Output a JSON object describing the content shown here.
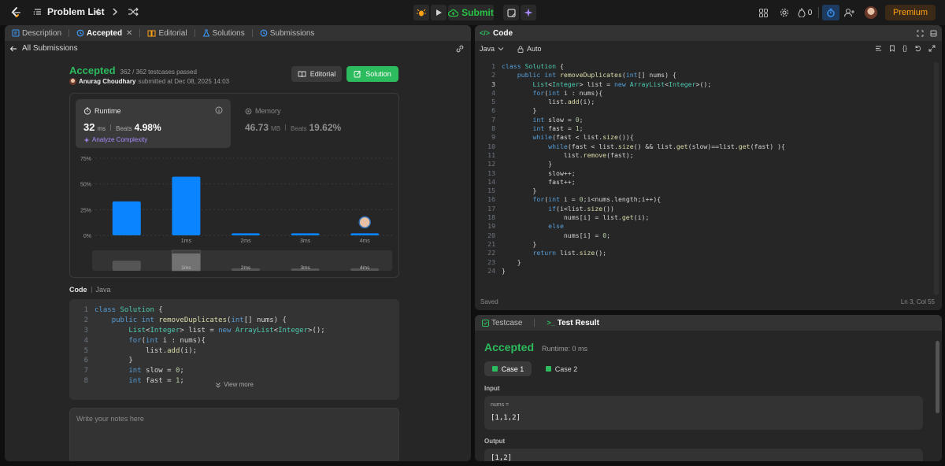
{
  "topbar": {
    "problem_list_label": "Problem List",
    "submit_label": "Submit",
    "streak_count": "0",
    "premium_label": "Premium"
  },
  "left_panel": {
    "tabs": [
      {
        "label": "Description"
      },
      {
        "label": "Accepted"
      },
      {
        "label": "Editorial"
      },
      {
        "label": "Solutions"
      },
      {
        "label": "Submissions"
      }
    ],
    "back_label": "All Submissions",
    "status": "Accepted",
    "testcases": "362 / 362 testcases passed",
    "author": "Anurag Choudhary",
    "submitted_text": "submitted at Dec 08, 2025 14:03",
    "editorial_btn": "Editorial",
    "solution_btn": "Solution",
    "runtime": {
      "title": "Runtime",
      "value": "32",
      "unit": "ms",
      "beats_label": "Beats",
      "beats_value": "4.98%",
      "analyze_label": "Analyze Complexity"
    },
    "memory": {
      "title": "Memory",
      "value": "46.73",
      "unit": "MB",
      "beats_label": "Beats",
      "beats_value": "19.62%"
    },
    "code_label": "Code",
    "code_lang": "Java",
    "view_more": "View more",
    "notes_placeholder": "Write your notes here"
  },
  "chart_data": {
    "type": "bar",
    "categories": [
      "",
      "1ms",
      "2ms",
      "3ms",
      "4ms"
    ],
    "values": [
      33,
      57,
      2,
      2,
      2
    ],
    "yticks": [
      "75%",
      "50%",
      "25%",
      "0%"
    ],
    "ylim": [
      0,
      75
    ],
    "mini_labels": [
      "1ms",
      "2ms",
      "3ms",
      "4ms"
    ],
    "bar_color": "#0a84ff"
  },
  "code_panel": {
    "title": "Code",
    "language": "Java",
    "mode": "Auto",
    "saved": "Saved",
    "cursor": "Ln 3, Col 55"
  },
  "code_lines": [
    "class Solution {",
    "    public int removeDuplicates(int[] nums) {",
    "        List<Integer> list = new ArrayList<Integer>();",
    "        for(int i : nums){",
    "            list.add(i);",
    "        }",
    "        int slow = 0;",
    "        int fast = 1;",
    "        while(fast < list.size()){",
    "            while(fast < list.size() && list.get(slow)==list.get(fast) ){",
    "                list.remove(fast);",
    "            }",
    "            slow++;",
    "            fast++;",
    "        }",
    "        for(int i = 0;i<nums.length;i++){",
    "            if(i<list.size())",
    "                nums[i] = list.get(i);",
    "            else",
    "                nums[i] = 0;",
    "        }",
    "        return list.size();",
    "    }",
    "}"
  ],
  "test_panel": {
    "tab_testcase": "Testcase",
    "tab_result": "Test Result",
    "status": "Accepted",
    "runtime": "Runtime: 0 ms",
    "case1": "Case 1",
    "case2": "Case 2",
    "input_label": "Input",
    "param_name": "nums =",
    "param_value": "[1,1,2]",
    "output_label": "Output",
    "output_value": "[1,2]"
  },
  "colors": {
    "accent_green": "#2cbb5d",
    "accent_orange": "#ffa116",
    "bar_blue": "#0a84ff"
  }
}
